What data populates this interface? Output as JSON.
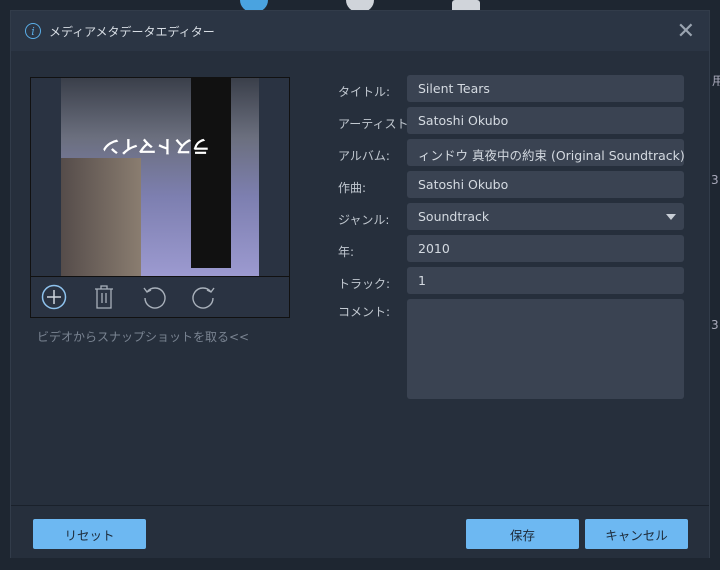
{
  "background": {
    "fragments": [
      "用",
      "3:",
      "3:"
    ]
  },
  "dialog": {
    "title": "メディアメタデータエディター",
    "info_icon": "info-icon",
    "close_icon": "close-icon"
  },
  "artwork": {
    "cover_text": "ラストマイン",
    "tools": [
      "add-icon",
      "trash-icon",
      "rotate-left-icon",
      "rotate-right-icon"
    ],
    "snapshot_link": "ビデオからスナップショットを取る<<"
  },
  "fields": [
    {
      "label": "タイトル:",
      "value": "Silent Tears"
    },
    {
      "label": "アーティスト:",
      "value": "Satoshi Okubo"
    },
    {
      "label": "アルバム:",
      "value": "ィンドウ 真夜中の約束 (Original Soundtrack)"
    },
    {
      "label": "作曲:",
      "value": "Satoshi Okubo"
    },
    {
      "label": "ジャンル:",
      "value": "Soundtrack"
    },
    {
      "label": "年:",
      "value": "2010"
    },
    {
      "label": "トラック:",
      "value": "1"
    },
    {
      "label": "コメント:",
      "value": ""
    }
  ],
  "footer": {
    "reset": "リセット",
    "save": "保存",
    "cancel": "キャンセル"
  },
  "colors": {
    "accent": "#6db8f2",
    "dialog_bg": "#262f3c",
    "field_bg": "#3a4352"
  }
}
